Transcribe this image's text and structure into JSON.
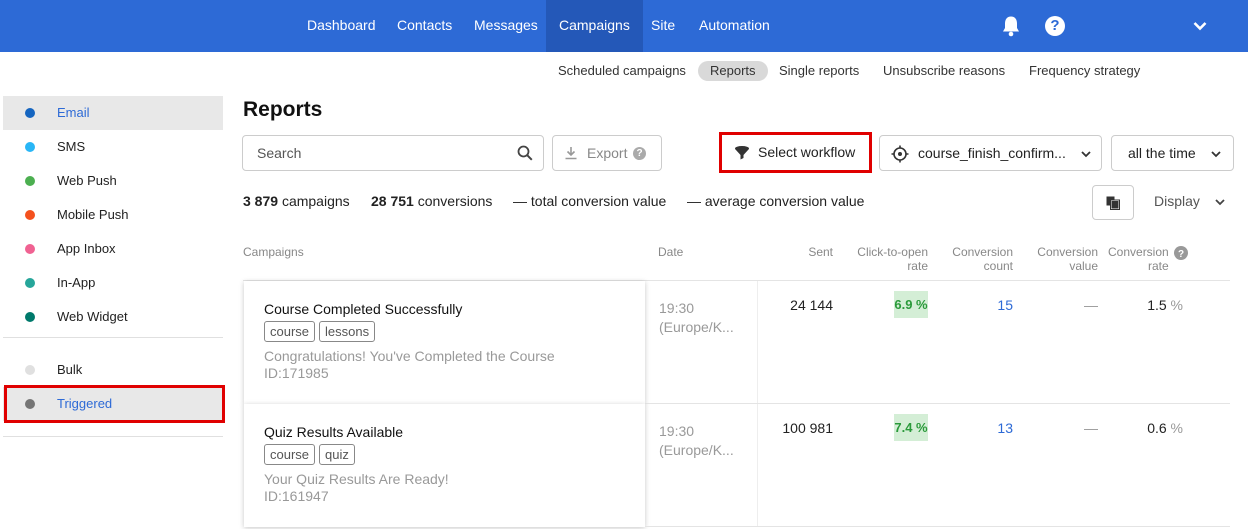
{
  "topnav": {
    "items": [
      "Dashboard",
      "Contacts",
      "Messages",
      "Campaigns",
      "Site",
      "Automation"
    ],
    "active": "Campaigns",
    "help_glyph": "?",
    "icons": [
      "bell-icon",
      "help-icon",
      "chevron-down-icon"
    ]
  },
  "subnav": {
    "items": [
      "Scheduled campaigns",
      "Reports",
      "Single reports",
      "Unsubscribe reasons",
      "Frequency strategy"
    ],
    "active": "Reports"
  },
  "sidebar": {
    "channels": [
      {
        "label": "Email",
        "color": "#1565c0"
      },
      {
        "label": "SMS",
        "color": "#29b6f6"
      },
      {
        "label": "Web Push",
        "color": "#4caf50"
      },
      {
        "label": "Mobile Push",
        "color": "#f4511e"
      },
      {
        "label": "App Inbox",
        "color": "#f06292"
      },
      {
        "label": "In-App",
        "color": "#26a69a"
      },
      {
        "label": "Web Widget",
        "color": "#00796b"
      }
    ],
    "types": [
      {
        "label": "Bulk",
        "color": "#e0e0e0"
      },
      {
        "label": "Triggered",
        "color": "#757575"
      }
    ]
  },
  "main": {
    "title": "Reports",
    "search_placeholder": "Search",
    "export_label": "Export",
    "export_help_glyph": "?",
    "select_workflow_label": "Select workflow",
    "workflow_value": "course_finish_confirm...",
    "time_range": "all the time",
    "stats": {
      "campaigns_count": "3 879",
      "campaigns_label": "campaigns",
      "conversions_count": "28 751",
      "conversions_label": "conversions",
      "total_value": "— total conversion value",
      "average_value": "— average conversion value"
    },
    "display_label": "Display"
  },
  "table": {
    "headers": {
      "campaigns": "Campaigns",
      "date": "Date",
      "sent": "Sent",
      "ctor_1": "Click-to-open",
      "ctor_2": "rate",
      "ccount_1": "Conversion",
      "ccount_2": "count",
      "cvalue_1": "Conversion",
      "cvalue_2": "value",
      "crate_1": "Conversion",
      "crate_2": "rate"
    },
    "rows": [
      {
        "name": "Course Completed Successfully",
        "tags": [
          "course",
          "lessons"
        ],
        "subject": "Congratulations! You've Completed the Course",
        "id": "ID:171985",
        "time": "19:30",
        "tz": "(Europe/K...",
        "sent": "24 144",
        "ctor": "6.9 %",
        "conv_count": "15",
        "conv_value": "—",
        "conv_rate": "1.5",
        "conv_rate_unit": "%"
      },
      {
        "name": "Quiz Results Available",
        "tags": [
          "course",
          "quiz"
        ],
        "subject": "Your Quiz Results Are Ready!",
        "id": "ID:161947",
        "time": "19:30",
        "tz": "(Europe/K...",
        "sent": "100 981",
        "ctor": "7.4 %",
        "conv_count": "13",
        "conv_value": "—",
        "conv_rate": "0.6",
        "conv_rate_unit": "%"
      }
    ]
  }
}
